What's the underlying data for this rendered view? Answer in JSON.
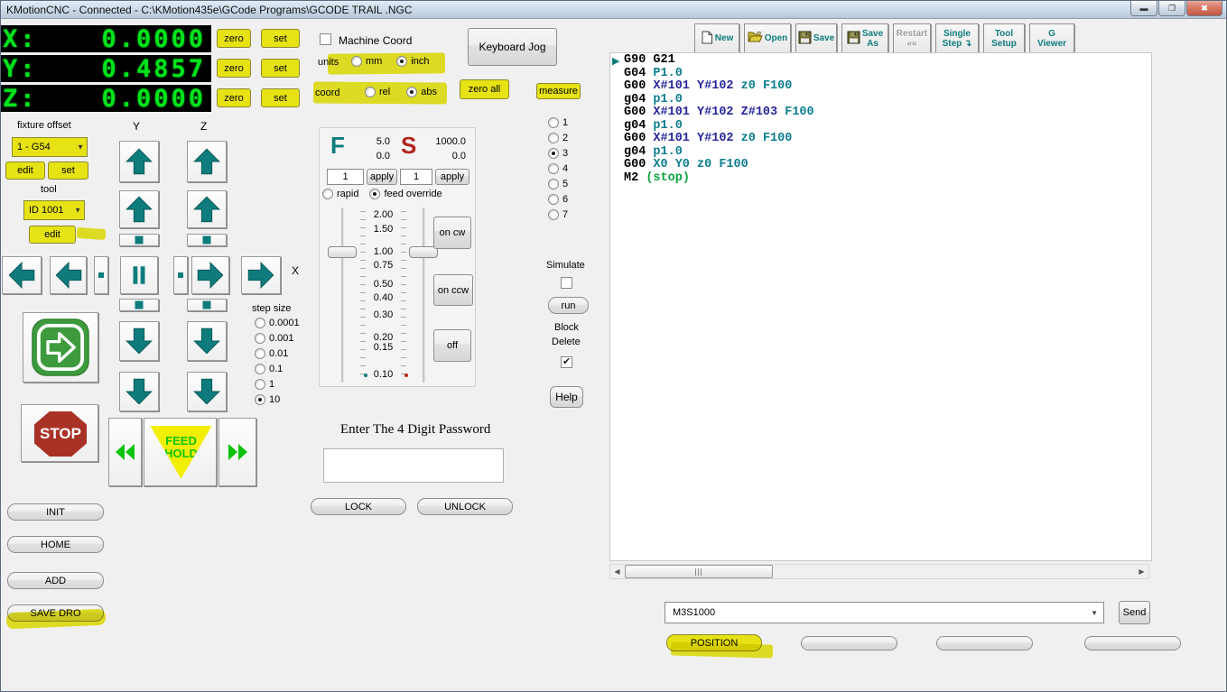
{
  "window": {
    "title": "KMotionCNC - Connected - C:\\KMotion435e\\GCode Programs\\GCODE TRAIL .NGC"
  },
  "dro": {
    "rows": [
      {
        "axis": "X:",
        "value": "0.0000"
      },
      {
        "axis": "Y:",
        "value": "0.4857"
      },
      {
        "axis": "Z:",
        "value": "0.0000"
      }
    ],
    "zero": "zero",
    "set": "set"
  },
  "coord_panel": {
    "machine_coord": "Machine Coord",
    "machine_coord_checked": false,
    "keyboard_jog": "Keyboard Jog",
    "units_label": "units",
    "units": [
      {
        "label": "mm",
        "selected": false
      },
      {
        "label": "inch",
        "selected": true
      }
    ],
    "coord_label": "coord",
    "coord": [
      {
        "label": "rel",
        "selected": false
      },
      {
        "label": "abs",
        "selected": true
      }
    ],
    "zero_all": "zero all",
    "measure": "measure"
  },
  "fixture_offset": {
    "label": "fixture offset",
    "value": "1 - G54",
    "edit": "edit",
    "set": "set"
  },
  "tool": {
    "label": "tool",
    "value": "ID 1001",
    "edit": "edit"
  },
  "jog": {
    "y_label": "Y",
    "z_label": "Z",
    "x_label": "X"
  },
  "step_size": {
    "label": "step size",
    "options": [
      "0.0001",
      "0.001",
      "0.01",
      "0.1",
      "1",
      "10"
    ],
    "selected": "10"
  },
  "feed_panel": {
    "f_label": "F",
    "f_set": "5.0",
    "f_actual": "0.0",
    "s_label": "S",
    "s_set": "1000.0",
    "s_actual": "0.0",
    "f_input": "1",
    "s_input": "1",
    "apply": "apply",
    "modes": [
      {
        "label": "rapid",
        "selected": false
      },
      {
        "label": "feed override",
        "selected": true
      }
    ],
    "scale": [
      "2.00",
      "1.50",
      "1.00",
      "0.75",
      "0.50",
      "0.40",
      "0.30",
      "0.20",
      "0.15",
      "0.10"
    ],
    "spindle": {
      "on_cw": "on cw",
      "on_ccw": "on ccw",
      "off": "off"
    }
  },
  "emergency": {
    "stop": "STOP",
    "feed_hold_line1": "FEED",
    "feed_hold_line2": "HOLD"
  },
  "left_buttons": {
    "init": "INIT",
    "home": "HOME",
    "add": "ADD",
    "save_dro": "SAVE DRO"
  },
  "thread_selector": {
    "options": [
      "1",
      "2",
      "3",
      "4",
      "5",
      "6",
      "7"
    ],
    "selected": "3"
  },
  "run_panel": {
    "simulate": "Simulate",
    "simulate_checked": false,
    "run": "run",
    "block_line1": "Block",
    "block_line2": "Delete",
    "block_delete_checked": true,
    "help": "Help"
  },
  "password_panel": {
    "label": "Enter The 4 Digit Password",
    "value": "",
    "lock": "LOCK",
    "unlock": "UNLOCK"
  },
  "toolbar": {
    "buttons": [
      {
        "name": "new",
        "icon": "new-page-icon",
        "lines": [
          "New"
        ],
        "disabled": false
      },
      {
        "name": "open",
        "icon": "open-folder-icon",
        "lines": [
          "Open"
        ],
        "disabled": false
      },
      {
        "name": "save",
        "icon": "floppy-icon",
        "lines": [
          "Save"
        ],
        "disabled": false
      },
      {
        "name": "save-as",
        "icon": "floppy-icon",
        "lines": [
          "Save",
          "As"
        ],
        "disabled": false
      },
      {
        "name": "restart",
        "icon": "",
        "lines": [
          "Restart",
          "««"
        ],
        "disabled": true
      },
      {
        "name": "single-step",
        "icon": "step-arrow-icon",
        "lines": [
          "Single",
          "Step ↴"
        ],
        "disabled": false
      },
      {
        "name": "tool-setup",
        "icon": "",
        "lines": [
          "Tool",
          "Setup"
        ],
        "disabled": false
      },
      {
        "name": "g-viewer",
        "icon": "",
        "lines": [
          "G",
          "Viewer"
        ],
        "disabled": false
      }
    ]
  },
  "gcode": {
    "syntax_colors": {
      "cmd": "#000000",
      "param": "#26269e",
      "val": "#0c7d8e",
      "comment": "#0ba33e"
    },
    "lines": [
      [
        [
          "G90 G21",
          "cmd"
        ]
      ],
      [
        [
          "G04 ",
          "cmd"
        ],
        [
          "P1.0",
          "val"
        ]
      ],
      [
        [
          "G00 ",
          "cmd"
        ],
        [
          "X#101 ",
          "param"
        ],
        [
          "Y#102 ",
          "param"
        ],
        [
          "z0 ",
          "val"
        ],
        [
          "F100",
          "val"
        ]
      ],
      [
        [
          "g04 ",
          "cmd"
        ],
        [
          "p1.0",
          "val"
        ]
      ],
      [
        [
          "G00 ",
          "cmd"
        ],
        [
          "X#101 ",
          "param"
        ],
        [
          "Y#102 ",
          "param"
        ],
        [
          "Z#103 ",
          "param"
        ],
        [
          "F100",
          "val"
        ]
      ],
      [
        [
          "g04 ",
          "cmd"
        ],
        [
          "p1.0",
          "val"
        ]
      ],
      [
        [
          "G00 ",
          "cmd"
        ],
        [
          "X#101 ",
          "param"
        ],
        [
          "Y#102 ",
          "param"
        ],
        [
          "z0 ",
          "val"
        ],
        [
          "F100",
          "val"
        ]
      ],
      [
        [
          "g04 ",
          "cmd"
        ],
        [
          "p1.0",
          "val"
        ]
      ],
      [
        [
          "G00 ",
          "cmd"
        ],
        [
          "X0 Y0 z0 F100",
          "val"
        ]
      ],
      [
        [
          "M2 ",
          "cmd"
        ],
        [
          "(stop)",
          "comment"
        ]
      ]
    ]
  },
  "mdi": {
    "value": "M3S1000",
    "send": "Send"
  },
  "bottom_bar": {
    "position": "POSITION"
  }
}
